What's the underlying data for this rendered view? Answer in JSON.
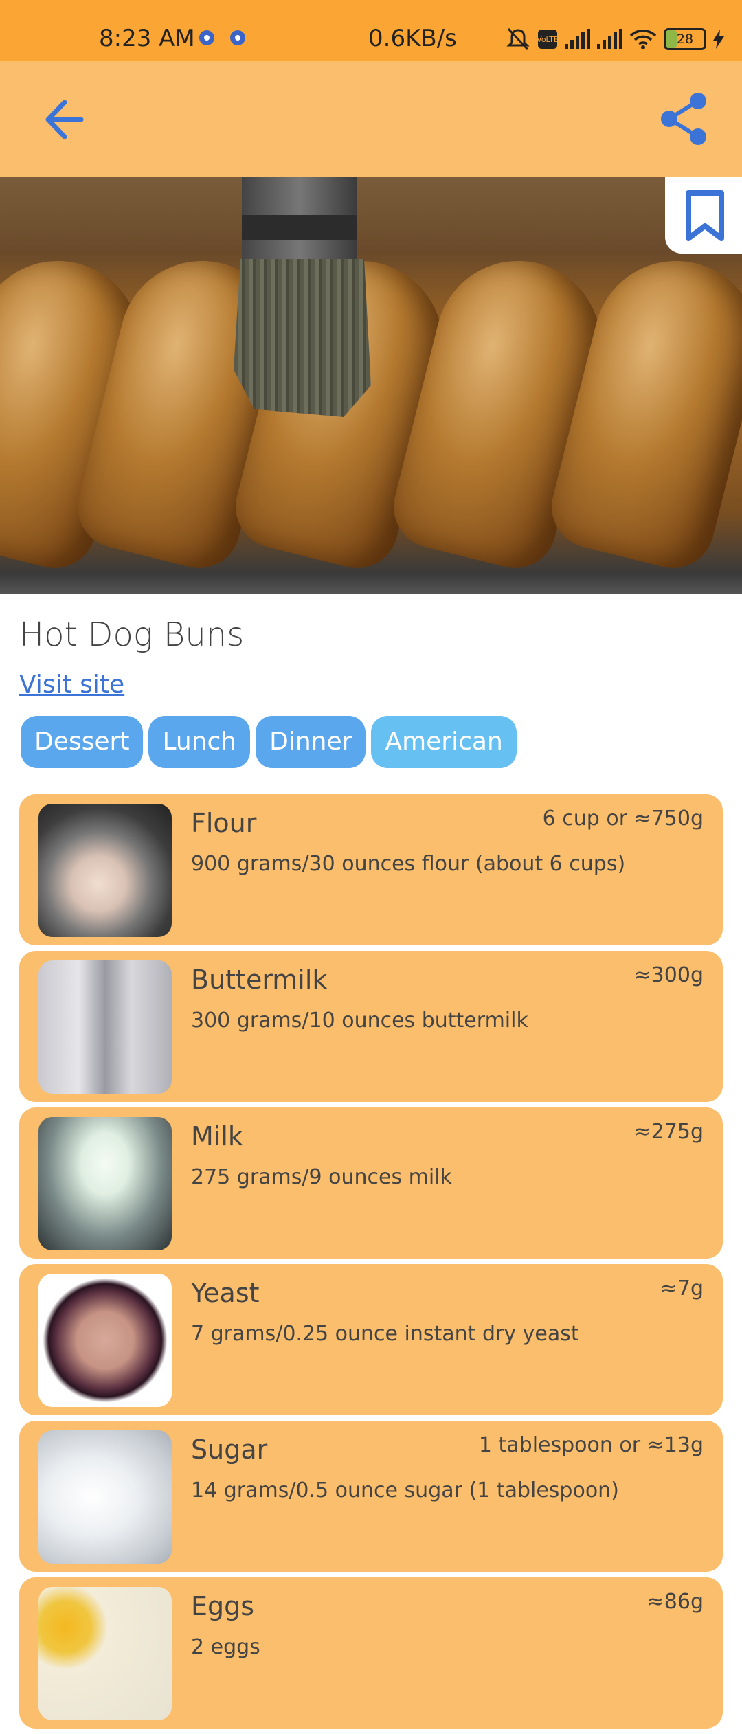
{
  "status_bar": {
    "time": "8:23 AM",
    "network_speed": "0.6KB/s",
    "battery_level": "28",
    "icons": [
      "settings-icon",
      "settings-icon",
      "mute-icon",
      "volte-icon",
      "signal-icon",
      "signal-icon",
      "wifi-icon",
      "battery-icon",
      "charging-icon"
    ]
  },
  "app_bar": {
    "back_icon": "arrow-left-icon",
    "share_icon": "share-icon",
    "accent_color": "#3b74d6",
    "background_color": "#FBBE6C"
  },
  "bookmark_icon": "bookmark-icon",
  "recipe": {
    "title": "Hot Dog Buns",
    "visit_site_label": "Visit site",
    "tags": [
      "Dessert",
      "Lunch",
      "Dinner",
      "American"
    ]
  },
  "ingredients": [
    {
      "name": "Flour",
      "amount": "6 cup or ≈750g",
      "description": "900 grams/30 ounces flour (about 6 cups)"
    },
    {
      "name": "Buttermilk",
      "amount": "≈300g",
      "description": "300 grams/10 ounces buttermilk"
    },
    {
      "name": "Milk",
      "amount": "≈275g",
      "description": "275 grams/9 ounces milk"
    },
    {
      "name": "Yeast",
      "amount": "≈7g",
      "description": "7 grams/0.25 ounce instant dry yeast"
    },
    {
      "name": "Sugar",
      "amount": "1 tablespoon or ≈13g",
      "description": "14 grams/0.5 ounce sugar (1 tablespoon)"
    },
    {
      "name": "Eggs",
      "amount": "≈86g",
      "description": "2 eggs"
    }
  ]
}
